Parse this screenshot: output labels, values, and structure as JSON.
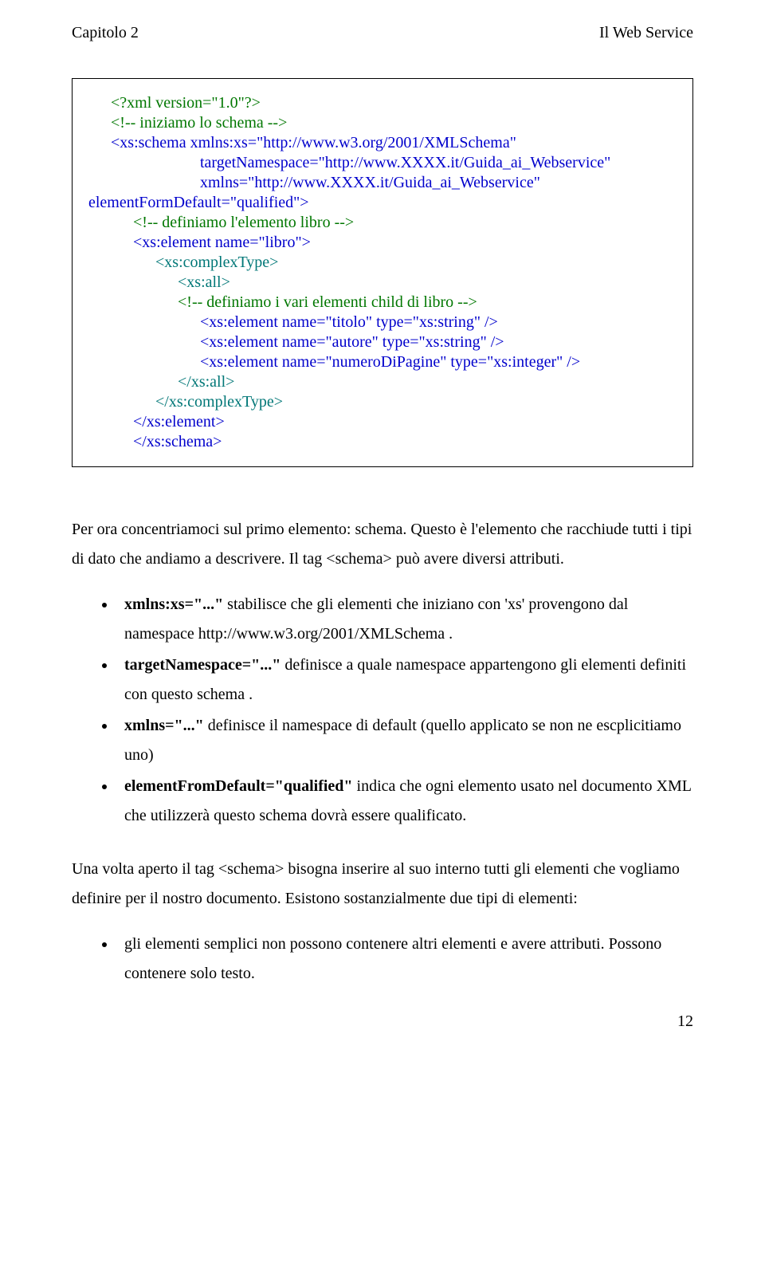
{
  "header": {
    "left": "Capitolo 2",
    "right": "Il Web Service"
  },
  "code": {
    "l1": "<?xml version=\"1.0\"?>",
    "l2": "<!-- iniziamo lo schema -->",
    "l3": "<xs:schema xmlns:xs=\"http://www.w3.org/2001/XMLSchema\"",
    "l4": "targetNamespace=\"http://www.XXXX.it/Guida_ai_Webservice\"",
    "l5": "xmlns=\"http://www.XXXX.it/Guida_ai_Webservice\"",
    "l6": "elementFormDefault=\"qualified\">",
    "l7": "<!-- definiamo l'elemento libro -->",
    "l8": "<xs:element name=\"libro\">",
    "l9": "<xs:complexType>",
    "l10": "<xs:all>",
    "l11": "<!-- definiamo i vari elementi child di libro -->",
    "l12": "<xs:element name=\"titolo\" type=\"xs:string\" />",
    "l13": "<xs:element name=\"autore\" type=\"xs:string\" />",
    "l14": "<xs:element name=\"numeroDiPagine\" type=\"xs:integer\" />",
    "l15": "</xs:all>",
    "l16": "</xs:complexType>",
    "l17": "</xs:element>",
    "l18": "</xs:schema>"
  },
  "para1": "Per ora concentriamoci sul primo elemento: schema. Questo è l'elemento che racchiude tutti i tipi di dato che andiamo a descrivere. Il tag <schema> può avere diversi attributi.",
  "bullets1": [
    {
      "bold": "xmlns:xs=\"...\"",
      "rest": " stabilisce che gli elementi che iniziano con 'xs' provengono dal namespace http://www.w3.org/2001/XMLSchema ."
    },
    {
      "bold": "targetNamespace=\"...\"",
      "rest": " definisce a quale namespace appartengono gli elementi definiti con questo schema ."
    },
    {
      "bold": "xmlns=\"...\"",
      "rest": " definisce il namespace di default (quello applicato se non ne escplicitiamo uno)"
    },
    {
      "bold": "elementFromDefault=\"qualified\"",
      "rest": " indica che ogni elemento usato nel documento XML che utilizzerà questo schema dovrà essere qualificato."
    }
  ],
  "para2": "Una volta aperto il tag <schema> bisogna inserire al suo interno tutti gli elementi che vogliamo definire per il nostro documento. Esistono sostanzialmente due tipi di elementi:",
  "bullets2": [
    "gli elementi semplici non possono contenere altri elementi e avere attributi. Possono contenere solo testo."
  ],
  "pageNumber": "12"
}
